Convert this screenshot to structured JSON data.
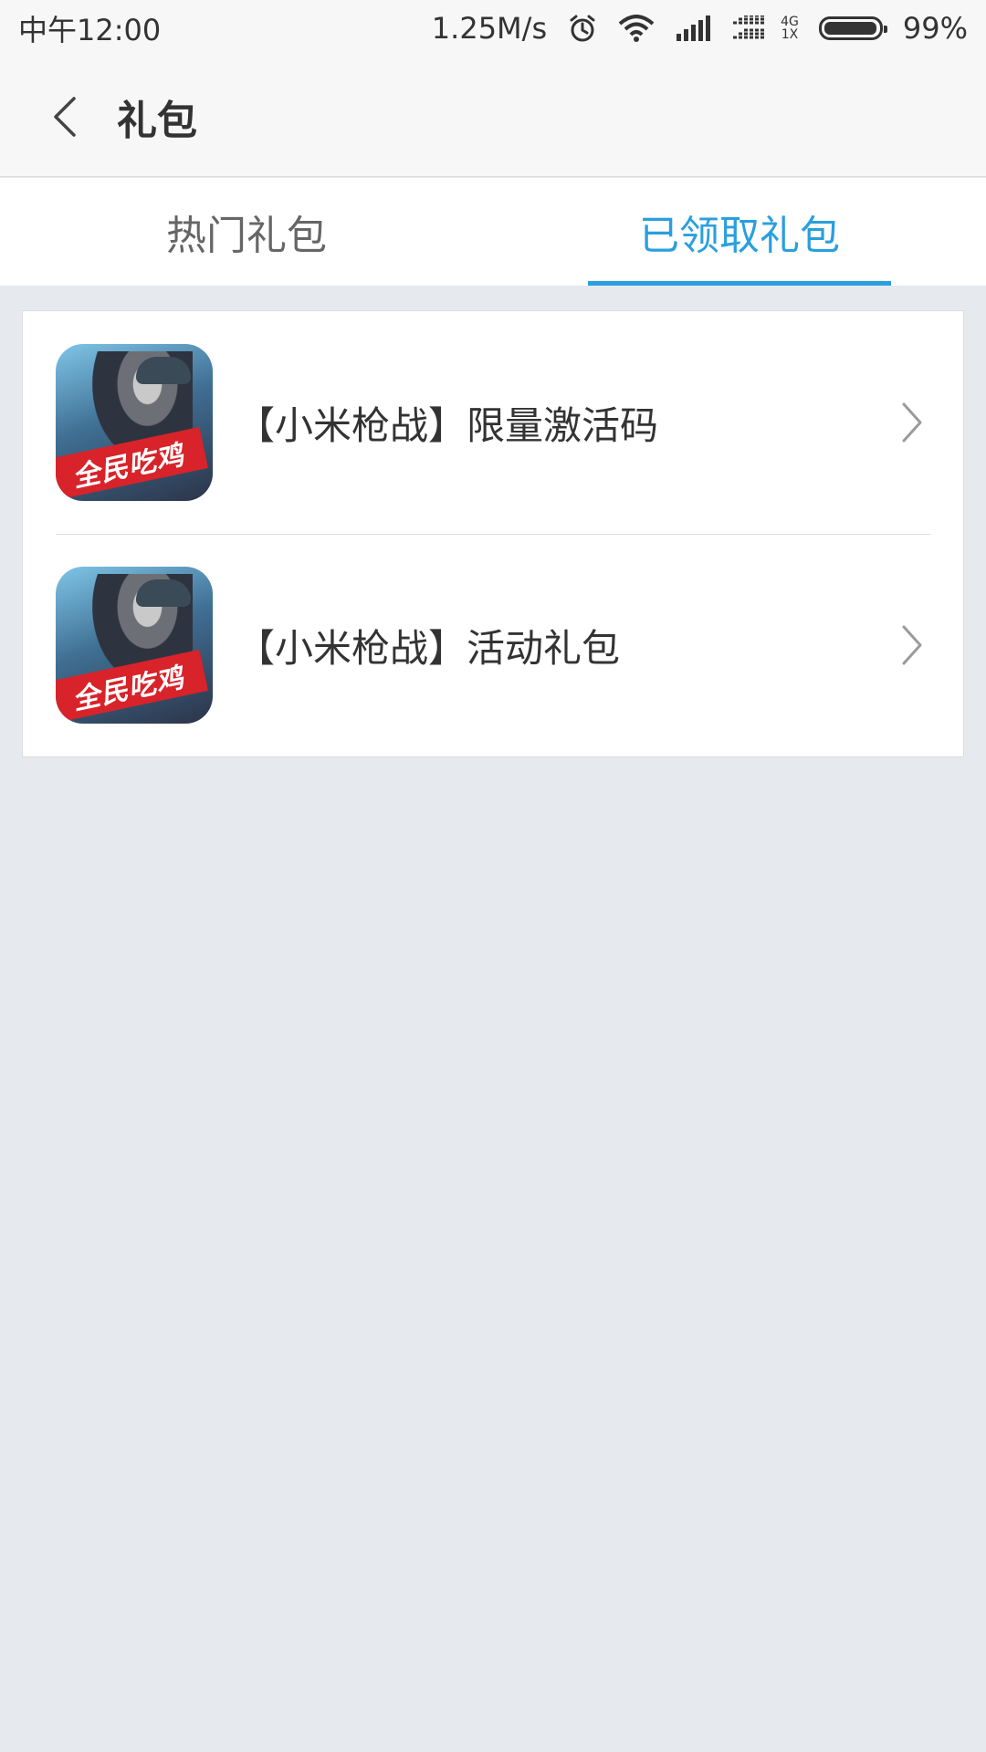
{
  "status_bar": {
    "time": "中午12:00",
    "speed": "1.25M/s",
    "network_top": "4G",
    "network_bottom": "1X",
    "battery": "99%",
    "battery_level": 0.99
  },
  "header": {
    "title": "礼包"
  },
  "tabs": [
    {
      "label": "热门礼包",
      "active": false
    },
    {
      "label": "已领取礼包",
      "active": true
    }
  ],
  "gifts": [
    {
      "title": "【小米枪战】限量激活码",
      "icon_banner": "全民吃鸡"
    },
    {
      "title": "【小米枪战】活动礼包",
      "icon_banner": "全民吃鸡"
    }
  ],
  "colors": {
    "accent": "#2a9fde",
    "background": "#e6e9ee",
    "card": "#ffffff"
  }
}
